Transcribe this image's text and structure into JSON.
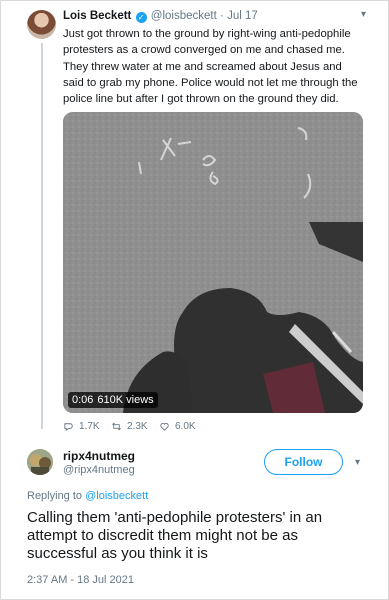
{
  "tweet": {
    "name": "Lois Beckett",
    "handle": "@loisbeckett",
    "sep": "·",
    "date": "Jul 17",
    "text": "Just got thrown to the ground by right-wing anti-pedophile protesters as a crowd converged on me and chased me. They threw water at me and screamed about Jesus and said to grab my phone. Police would not let me through the police line but after I got thrown on the ground they did.",
    "video_time": "0:06",
    "video_views": "610K views",
    "replies": "1.7K",
    "retweets": "2.3K",
    "likes": "6.0K"
  },
  "reply": {
    "name": "ripx4nutmeg",
    "handle": "@ripx4nutmeg",
    "follow_label": "Follow",
    "replying_prefix": "Replying to",
    "replying_to": "@loisbeckett",
    "text": "Calling them 'anti-pedophile protesters' in an attempt to discredit them might not be as successful as you think it is",
    "timestamp": "2:37 AM - 18 Jul 2021"
  },
  "icons": {
    "verified": "verified-badge-icon",
    "reply": "reply-icon",
    "retweet": "retweet-icon",
    "like": "heart-icon",
    "more": "chevron-down-icon"
  },
  "colors": {
    "accent": "#1da1f2",
    "muted": "#657786",
    "text": "#14171a"
  }
}
